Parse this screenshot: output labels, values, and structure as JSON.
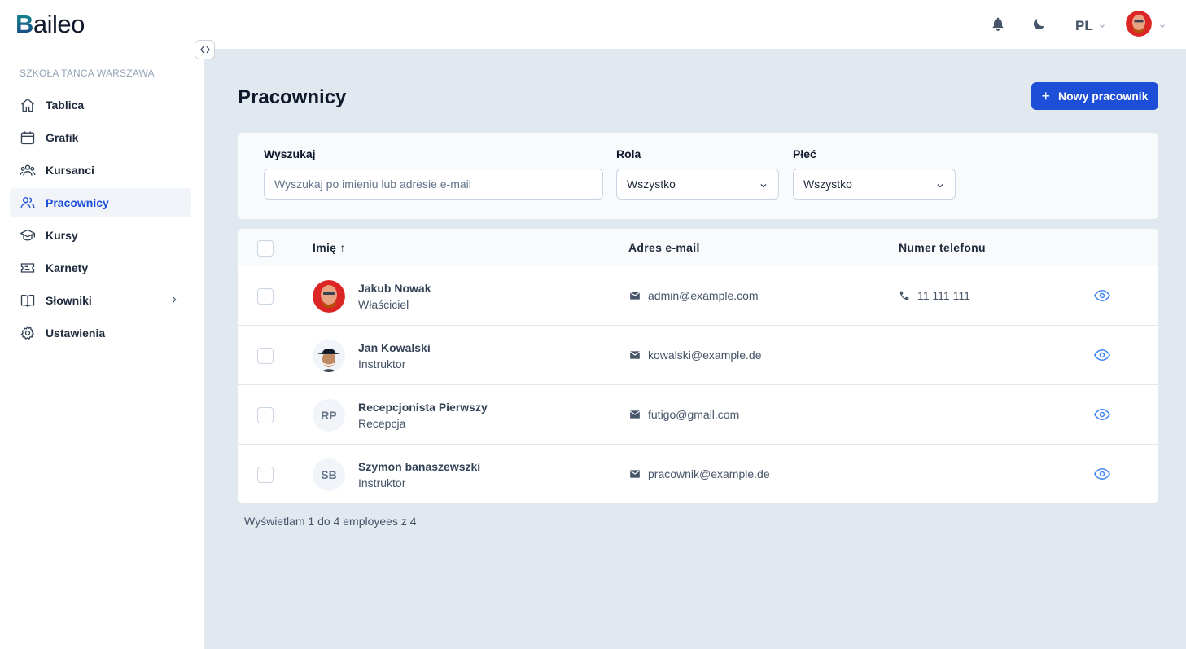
{
  "app": {
    "logo_letter": "B",
    "logo_rest": "aileo",
    "school_name": "SZKOŁA TAŃCA WARSZAWA"
  },
  "sidebar": {
    "items": [
      {
        "label": "Tablica",
        "icon": "home-icon"
      },
      {
        "label": "Grafik",
        "icon": "calendar-icon"
      },
      {
        "label": "Kursanci",
        "icon": "users-group-icon"
      },
      {
        "label": "Pracownicy",
        "icon": "users-icon",
        "active": true
      },
      {
        "label": "Kursy",
        "icon": "graduation-cap-icon"
      },
      {
        "label": "Karnety",
        "icon": "ticket-icon"
      },
      {
        "label": "Słowniki",
        "icon": "book-icon",
        "has_submenu": true
      },
      {
        "label": "Ustawienia",
        "icon": "gear-icon"
      }
    ]
  },
  "topbar": {
    "language": "PL"
  },
  "page": {
    "title": "Pracownicy",
    "new_button_label": "Nowy pracownik"
  },
  "filters": {
    "search_label": "Wyszukaj",
    "search_placeholder": "Wyszukaj po imieniu lub adresie e-mail",
    "role_label": "Rola",
    "role_value": "Wszystko",
    "gender_label": "Płeć",
    "gender_value": "Wszystko"
  },
  "table": {
    "columns": {
      "name": "Imię ↑",
      "email": "Adres e-mail",
      "phone": "Numer telefonu"
    },
    "rows": [
      {
        "name": "Jakub Nowak",
        "role": "Właściciel",
        "email": "admin@example.com",
        "phone": "11 111 111",
        "avatar": "photo",
        "initials": ""
      },
      {
        "name": "Jan Kowalski",
        "role": "Instruktor",
        "email": "kowalski@example.de",
        "phone": "",
        "avatar": "photo",
        "initials": ""
      },
      {
        "name": "Recepcjonista Pierwszy",
        "role": "Recepcja",
        "email": "futigo@gmail.com",
        "phone": "",
        "avatar": "initials",
        "initials": "RP"
      },
      {
        "name": "Szymon banaszewszki",
        "role": "Instruktor",
        "email": "pracownik@example.de",
        "phone": "",
        "avatar": "initials",
        "initials": "SB"
      }
    ]
  },
  "footer": {
    "pagination_text": "Wyświetlam 1 do 4 employees z 4"
  },
  "colors": {
    "primary": "#1d4ed8",
    "background": "#e2e8f0",
    "eye_icon": "#3b82f6"
  }
}
